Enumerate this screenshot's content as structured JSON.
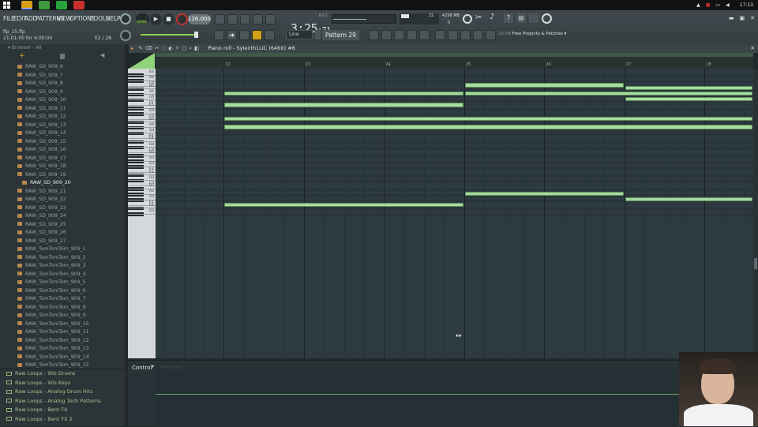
{
  "taskbar": {
    "apps": [
      {
        "icon": "fl-studio-icon",
        "color": "#d4a017"
      },
      {
        "icon": "file-explorer-icon",
        "color": "#3d9b3d"
      },
      {
        "icon": "green-app-icon",
        "color": "#27a33b"
      },
      {
        "icon": "red-app-icon",
        "color": "#c9302c"
      }
    ],
    "clock": "17:13"
  },
  "toolbar": {
    "menus": [
      "FILE",
      "EDIT",
      "ADD",
      "PATTERNS",
      "VIEW",
      "OPTIONS",
      "TOOLS",
      "HELP"
    ],
    "mode_label": "SONG",
    "tempo": "126.000",
    "time_main": "3:25",
    "time_sub": ":71",
    "time_unit": "B:S:T",
    "cpu_value": "22",
    "memory": "4298 MB",
    "voices": "0",
    "snap_mode": "Line",
    "pattern": "Pattern 29",
    "hint_date": "20:08",
    "hint_text": "Free Projects & Patches"
  },
  "project": {
    "filename": "flp_15.flp",
    "timing": "21:01:00 for 4:00:00",
    "counter": "E2 / 28"
  },
  "browser": {
    "title": "Browser - All",
    "items": [
      "RAW_SD_909_6",
      "RAW_SD_909_7",
      "RAW_SD_909_8",
      "RAW_SD_909_9",
      "RAW_SD_909_10",
      "RAW_SD_909_11",
      "RAW_SD_909_12",
      "RAW_SD_909_13",
      "RAW_SD_909_14",
      "RAW_SD_909_15",
      "RAW_SD_909_16",
      "RAW_SD_909_17",
      "RAW_SD_909_18",
      "RAW_SD_909_19",
      "RAW_SD_909_20",
      "RAW_SD_909_21",
      "RAW_SD_909_22",
      "RAW_SD_909_23",
      "RAW_SD_909_24",
      "RAW_SD_909_25",
      "RAW_SD_909_26",
      "RAW_SD_909_27",
      "RAW_TomTomTom_909_1",
      "RAW_TomTomTom_909_2",
      "RAW_TomTomTom_909_3",
      "RAW_TomTomTom_909_4",
      "RAW_TomTomTom_909_5",
      "RAW_TomTomTom_909_6",
      "RAW_TomTomTom_909_7",
      "RAW_TomTomTom_909_8",
      "RAW_TomTomTom_909_9",
      "RAW_TomTomTom_909_10",
      "RAW_TomTomTom_909_11",
      "RAW_TomTomTom_909_12",
      "RAW_TomTomTom_909_13",
      "RAW_TomTomTom_909_14",
      "RAW_TomTomTom_909_15"
    ],
    "selected_index": 14,
    "folders": [
      "Raw Loops - 90s Drums",
      "Raw Loops - 90s Keys",
      "Raw Loops - Analog Drum Hits",
      "Raw Loops - Analog Tech Patterns",
      "Raw Loops - Bent FX",
      "Raw Loops - Bent FX 2"
    ]
  },
  "piano_roll": {
    "title": "Piano roll - Sylenth1LIC (64bit) #6",
    "bars": [
      "22",
      "23",
      "24",
      "25",
      "26",
      "27",
      "28"
    ],
    "keys": [
      "E6",
      "D6",
      "C6",
      "B5",
      "A5",
      "G5",
      "F5",
      "E5",
      "D5",
      "C5",
      "B4",
      "A4",
      "G4",
      "F4",
      "E4",
      "D4",
      "C4",
      "B3",
      "A3",
      "G3",
      "F3",
      "E3",
      "D3",
      "C3",
      "B2",
      "A2",
      "G2",
      "F2",
      "E2",
      "D2"
    ],
    "notes": [
      {
        "key": "A5",
        "start": 22.0,
        "end": 25.0
      },
      {
        "key": "F5",
        "start": 22.0,
        "end": 25.0
      },
      {
        "key": "C5",
        "start": 22.0,
        "end": 29.0
      },
      {
        "key": "A4",
        "start": 22.0,
        "end": 29.0
      },
      {
        "key": "F2",
        "start": 22.0,
        "end": 25.0
      },
      {
        "key": "C6",
        "start": 25.0,
        "end": 27.0
      },
      {
        "key": "A5",
        "start": 25.0,
        "end": 29.0
      },
      {
        "key": "A2",
        "start": 25.0,
        "end": 27.0
      },
      {
        "key": "B5",
        "start": 27.0,
        "end": 29.0
      },
      {
        "key": "G5",
        "start": 27.0,
        "end": 29.0
      },
      {
        "key": "G2",
        "start": 27.0,
        "end": 29.0
      }
    ],
    "note_color": "#a6dca0",
    "control_label": "Control",
    "control_param": "Velocity"
  }
}
